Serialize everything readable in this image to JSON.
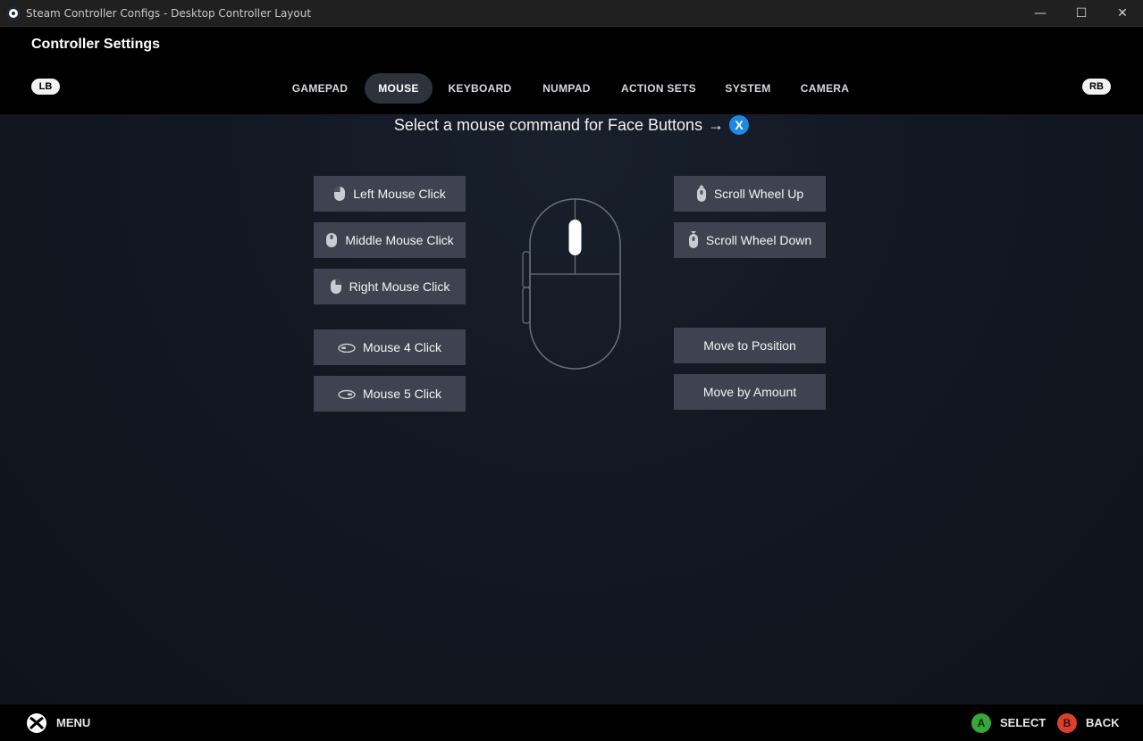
{
  "window": {
    "title": "Steam Controller Configs - Desktop Controller Layout",
    "controls": [
      "—",
      "☐",
      "✕"
    ]
  },
  "header": {
    "title": "Controller Settings",
    "lb": "LB",
    "rb": "RB",
    "tabs": [
      "GAMEPAD",
      "MOUSE",
      "KEYBOARD",
      "NUMPAD",
      "ACTION SETS",
      "SYSTEM",
      "CAMERA"
    ],
    "active_tab": "MOUSE"
  },
  "main": {
    "prompt": "Select a mouse command for Face Buttons",
    "arrow": "→",
    "button_glyph": "X",
    "left_commands": [
      {
        "label": "Left Mouse Click",
        "icon": "mouse-left-click-icon"
      },
      {
        "label": "Middle Mouse Click",
        "icon": "mouse-middle-click-icon"
      },
      {
        "label": "Right Mouse Click",
        "icon": "mouse-right-click-icon"
      },
      {
        "label": "Mouse 4 Click",
        "icon": "mouse-side-button-icon"
      },
      {
        "label": "Mouse 5 Click",
        "icon": "mouse-side-button-icon"
      }
    ],
    "right_commands": [
      {
        "label": "Scroll Wheel Up",
        "icon": "scroll-up-icon"
      },
      {
        "label": "Scroll Wheel Down",
        "icon": "scroll-down-icon"
      },
      {
        "label": "Move to Position",
        "icon": ""
      },
      {
        "label": "Move by Amount",
        "icon": ""
      }
    ]
  },
  "footer": {
    "menu": "MENU",
    "select_glyph": "A",
    "select": "SELECT",
    "back_glyph": "B",
    "back": "BACK"
  },
  "colors": {
    "accent": "#1e88e5",
    "button_bg": "#3d4350",
    "active_tab_bg": "#2e323b",
    "a_green": "#3aa53a",
    "b_red": "#d9412c"
  }
}
